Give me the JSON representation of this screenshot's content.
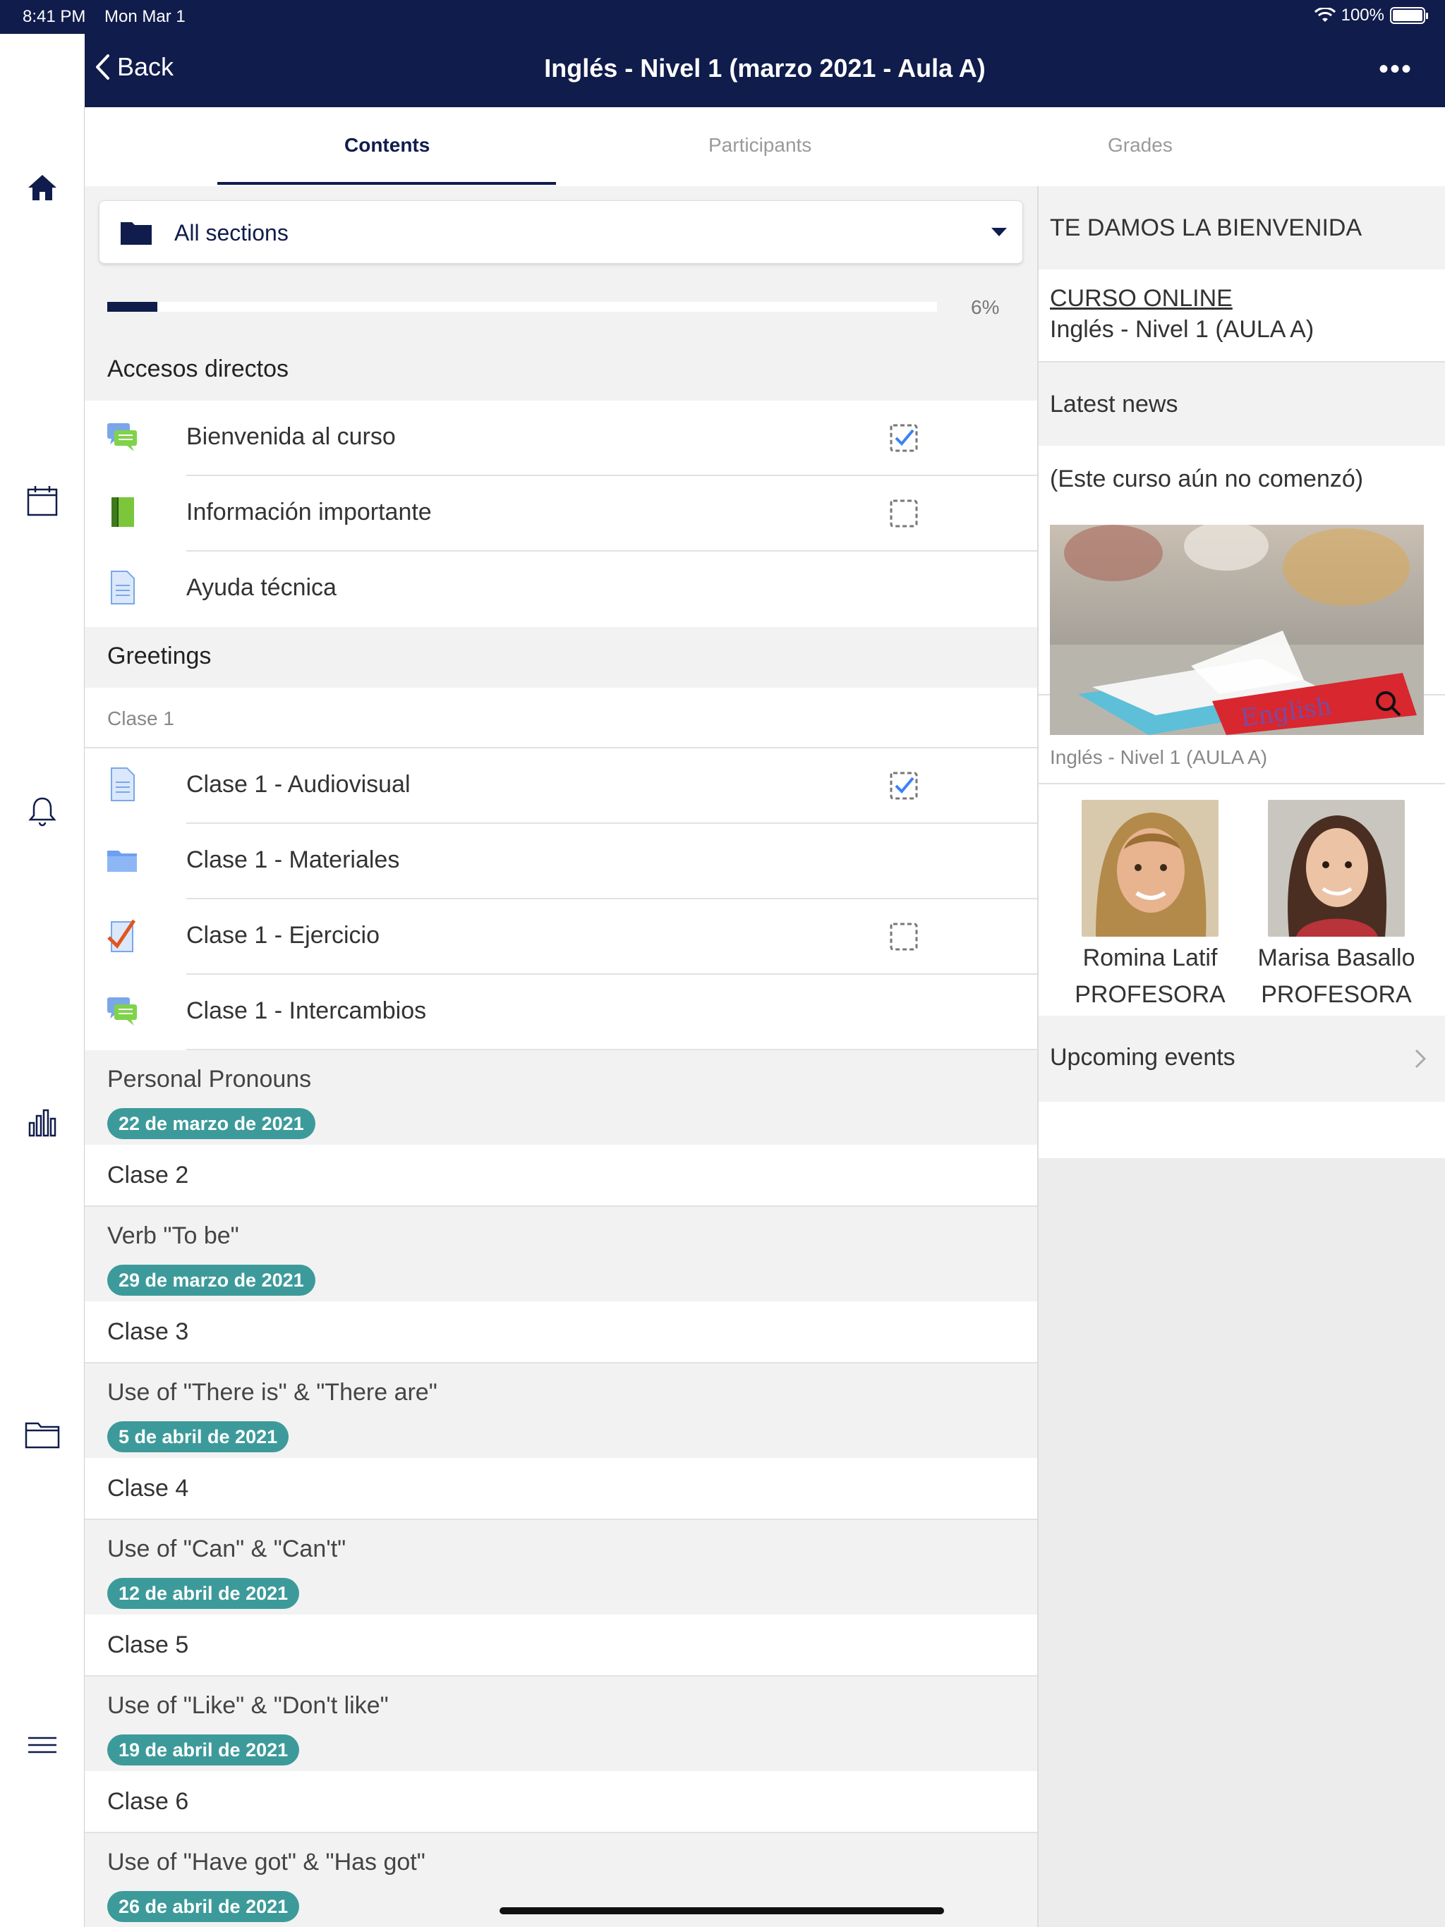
{
  "status": {
    "time": "8:41 PM",
    "date": "Mon Mar 1",
    "battery": "100%"
  },
  "nav": {
    "back_label": "Back",
    "title": "Inglés - Nivel 1 (marzo 2021 - Aula A)",
    "more_label": "•••"
  },
  "tabs": [
    {
      "label": "Contents",
      "active": true
    },
    {
      "label": "Participants",
      "active": false
    },
    {
      "label": "Grades",
      "active": false
    }
  ],
  "selector": {
    "label": "All sections"
  },
  "progress": {
    "value": 0.06,
    "label": "6%"
  },
  "sections": {
    "accesos": {
      "title": "Accesos directos",
      "items": [
        {
          "name": "Bienvenida al curso",
          "icon": "forum-icon",
          "check": "done"
        },
        {
          "name": "Información importante",
          "icon": "book-icon",
          "check": "pending"
        },
        {
          "name": "Ayuda técnica",
          "icon": "page-icon",
          "check": "none"
        }
      ]
    },
    "greetings": {
      "title": "Greetings",
      "subhead": "Clase 1",
      "items": [
        {
          "name": "Clase 1 - Audiovisual",
          "icon": "page-icon",
          "check": "done"
        },
        {
          "name": "Clase 1 - Materiales",
          "icon": "folder-icon",
          "check": "none"
        },
        {
          "name": "Clase 1 - Ejercicio",
          "icon": "assignment-icon",
          "check": "pending"
        },
        {
          "name": "Clase 1 - Intercambios",
          "icon": "forum-icon",
          "check": "none"
        }
      ]
    }
  },
  "topics": [
    {
      "title": "Personal Pronouns",
      "date": "22 de marzo de 2021",
      "row": "Clase 2"
    },
    {
      "title": "Verb \"To be\"",
      "date": "29 de marzo de 2021",
      "row": "Clase 3"
    },
    {
      "title": "Use of \"There is\" & \"There are\"",
      "date": "5 de abril de 2021",
      "row": "Clase 4"
    },
    {
      "title": "Use of \"Can\" & \"Can't\"",
      "date": "12 de abril de 2021",
      "row": "Clase 5"
    },
    {
      "title": "Use of \"Like\" & \"Don't like\"",
      "date": "19 de abril de 2021",
      "row": "Clase 6"
    },
    {
      "title": "Use of \"Have got\" & \"Has got\"",
      "date": "26 de abril de 2021",
      "row": ""
    }
  ],
  "side": {
    "welcome": "TE DAMOS LA BIENVENIDA",
    "course_link": "CURSO ONLINE",
    "course_name": "Inglés - Nivel 1 (AULA A)",
    "news_heading": "Latest news",
    "news_text": "(Este curso aún no comenzó)",
    "image_caption": "Inglés - Nivel 1 (AULA A)",
    "image_book_text": "English",
    "teachers": [
      {
        "name": "Romina Latif",
        "role": "PROFESORA"
      },
      {
        "name": "Marisa Basallo",
        "role": "PROFESORA"
      }
    ],
    "upcoming": "Upcoming events"
  },
  "colors": {
    "primary": "#101c4b",
    "pill": "#3d9a9a",
    "check": "#3b82f6"
  }
}
